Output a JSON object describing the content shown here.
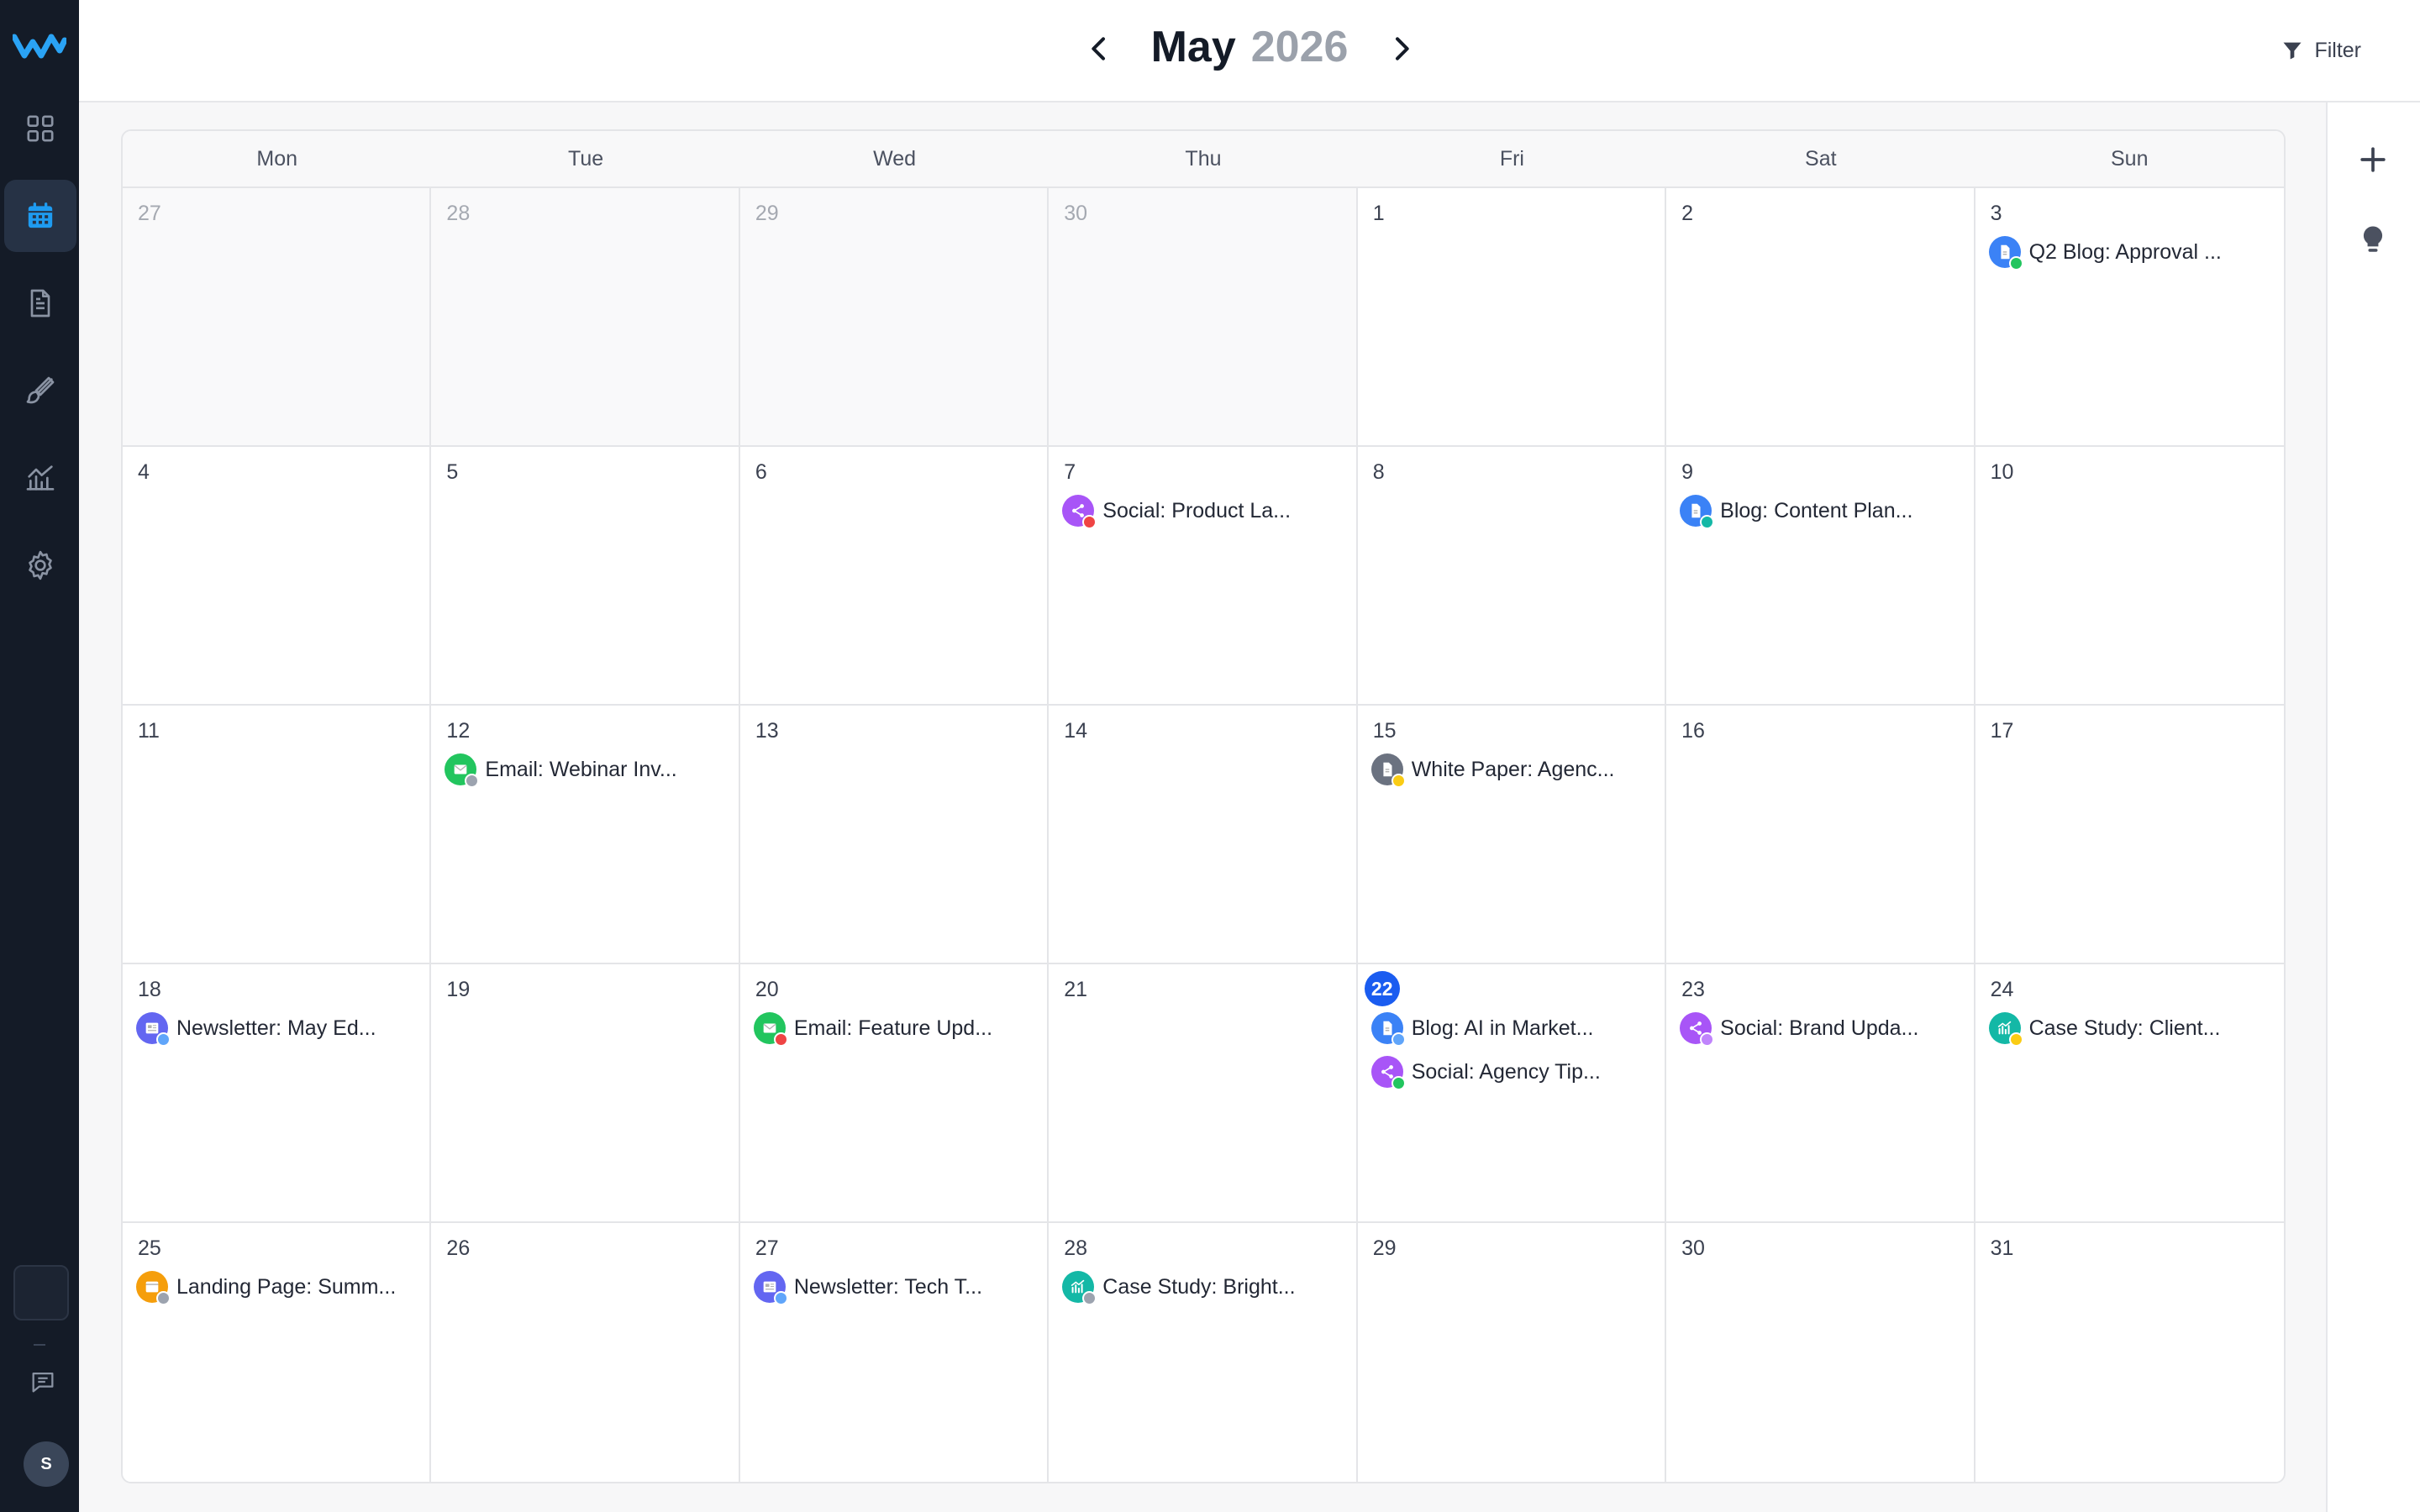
{
  "header": {
    "month": "May",
    "year": "2026",
    "filter_label": "Filter"
  },
  "sidebar": {
    "items": [
      {
        "name": "dashboard",
        "icon": "grid-icon"
      },
      {
        "name": "calendar",
        "icon": "calendar-icon",
        "active": true
      },
      {
        "name": "documents",
        "icon": "document-icon"
      },
      {
        "name": "design",
        "icon": "brush-icon"
      },
      {
        "name": "analytics",
        "icon": "chart-icon"
      },
      {
        "name": "settings",
        "icon": "gear-icon"
      }
    ],
    "avatar_initial": "S"
  },
  "weekdays": [
    "Mon",
    "Tue",
    "Wed",
    "Thu",
    "Fri",
    "Sat",
    "Sun"
  ],
  "days": [
    {
      "day": "27",
      "other": true
    },
    {
      "day": "28",
      "other": true
    },
    {
      "day": "29",
      "other": true
    },
    {
      "day": "30",
      "other": true
    },
    {
      "day": "1"
    },
    {
      "day": "2"
    },
    {
      "day": "3",
      "events": [
        {
          "type": "blog",
          "label": "Q2 Blog: Approval ...",
          "status": "#22c55e"
        }
      ]
    },
    {
      "day": "4"
    },
    {
      "day": "5"
    },
    {
      "day": "6"
    },
    {
      "day": "7",
      "events": [
        {
          "type": "social",
          "label": "Social: Product La...",
          "status": "#ef4444"
        }
      ]
    },
    {
      "day": "8"
    },
    {
      "day": "9",
      "events": [
        {
          "type": "blog",
          "label": "Blog: Content Plan...",
          "status": "#14b8a6"
        }
      ]
    },
    {
      "day": "10"
    },
    {
      "day": "11"
    },
    {
      "day": "12",
      "events": [
        {
          "type": "email",
          "label": "Email: Webinar Inv...",
          "status": "#9ca3af"
        }
      ]
    },
    {
      "day": "13"
    },
    {
      "day": "14"
    },
    {
      "day": "15",
      "events": [
        {
          "type": "whitepaper",
          "label": "White Paper: Agenc...",
          "status": "#facc15"
        }
      ]
    },
    {
      "day": "16"
    },
    {
      "day": "17"
    },
    {
      "day": "18",
      "events": [
        {
          "type": "newsletter",
          "label": "Newsletter: May Ed...",
          "status": "#60a5fa"
        }
      ]
    },
    {
      "day": "19"
    },
    {
      "day": "20",
      "events": [
        {
          "type": "email",
          "label": "Email: Feature Upd...",
          "status": "#ef4444"
        }
      ]
    },
    {
      "day": "21"
    },
    {
      "day": "22",
      "today": true,
      "events": [
        {
          "type": "blog",
          "label": "Blog: AI in Market...",
          "status": "#60a5fa"
        },
        {
          "type": "social",
          "label": "Social: Agency Tip...",
          "status": "#22c55e"
        }
      ]
    },
    {
      "day": "23",
      "events": [
        {
          "type": "social",
          "label": "Social: Brand Upda...",
          "status": "#c084fc"
        }
      ]
    },
    {
      "day": "24",
      "events": [
        {
          "type": "casestudy",
          "label": "Case Study: Client...",
          "status": "#facc15"
        }
      ]
    },
    {
      "day": "25",
      "events": [
        {
          "type": "landing",
          "label": "Landing Page: Summ...",
          "status": "#9ca3af"
        }
      ]
    },
    {
      "day": "26"
    },
    {
      "day": "27",
      "events": [
        {
          "type": "newsletter",
          "label": "Newsletter: Tech T...",
          "status": "#60a5fa"
        }
      ]
    },
    {
      "day": "28",
      "events": [
        {
          "type": "casestudy",
          "label": "Case Study: Bright...",
          "status": "#9ca3af"
        }
      ]
    },
    {
      "day": "29"
    },
    {
      "day": "30"
    },
    {
      "day": "31"
    }
  ],
  "event_types": {
    "blog": {
      "color": "#3b82f6",
      "icon": "document-icon"
    },
    "social": {
      "color": "#a855f7",
      "icon": "share-icon"
    },
    "email": {
      "color": "#22c55e",
      "icon": "mail-icon"
    },
    "whitepaper": {
      "color": "#6b7280",
      "icon": "document-icon"
    },
    "newsletter": {
      "color": "#6366f1",
      "icon": "newspaper-icon"
    },
    "casestudy": {
      "color": "#14b8a6",
      "icon": "chart-icon"
    },
    "landing": {
      "color": "#f59e0b",
      "icon": "browser-icon"
    }
  },
  "colors": {
    "accent": "#1a5cf0",
    "sidebar_bg": "#141b27",
    "sidebar_active": "#263245",
    "logo": "#2aa3f5"
  }
}
